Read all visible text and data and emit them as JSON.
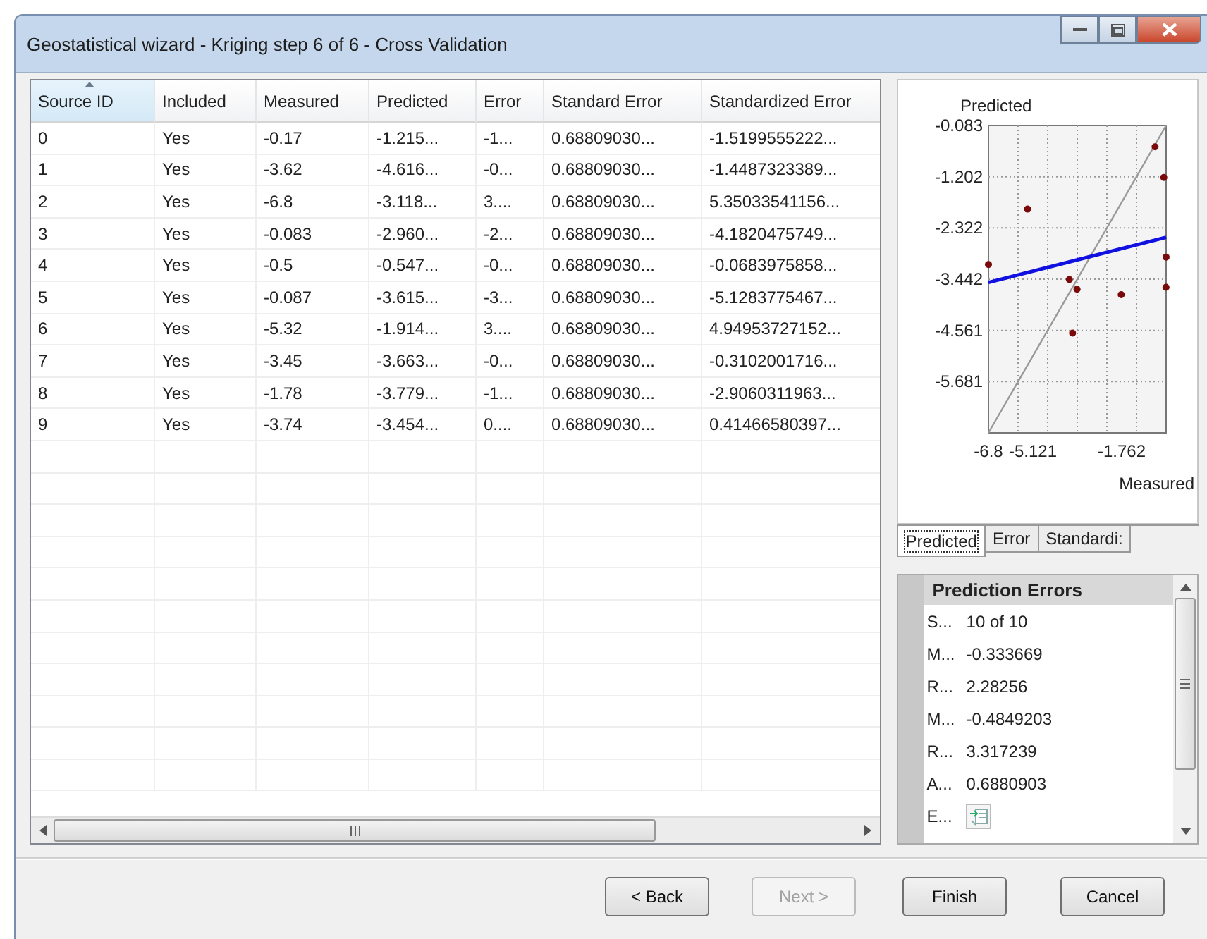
{
  "window": {
    "title": "Geostatistical wizard - Kriging step 6 of 6 - Cross Validation"
  },
  "table": {
    "columns": [
      {
        "label": "Source ID",
        "sorted": true
      },
      {
        "label": "Included",
        "sorted": false
      },
      {
        "label": "Measured",
        "sorted": false
      },
      {
        "label": "Predicted",
        "sorted": false
      },
      {
        "label": "Error",
        "sorted": false
      },
      {
        "label": "Standard Error",
        "sorted": false
      },
      {
        "label": "Standardized Error",
        "sorted": false
      }
    ],
    "rows": [
      [
        "0",
        "Yes",
        "-0.17",
        "-1.215...",
        "-1...",
        "0.68809030...",
        "-1.5199555222..."
      ],
      [
        "1",
        "Yes",
        "-3.62",
        "-4.616...",
        "-0...",
        "0.68809030...",
        "-1.4487323389..."
      ],
      [
        "2",
        "Yes",
        "-6.8",
        "-3.118...",
        "3....",
        "0.68809030...",
        "5.35033541156..."
      ],
      [
        "3",
        "Yes",
        "-0.083",
        "-2.960...",
        "-2...",
        "0.68809030...",
        "-4.1820475749..."
      ],
      [
        "4",
        "Yes",
        "-0.5",
        "-0.547...",
        "-0...",
        "0.68809030...",
        "-0.0683975858..."
      ],
      [
        "5",
        "Yes",
        "-0.087",
        "-3.615...",
        "-3...",
        "0.68809030...",
        "-5.1283775467..."
      ],
      [
        "6",
        "Yes",
        "-5.32",
        "-1.914...",
        "3....",
        "0.68809030...",
        "4.94953727152..."
      ],
      [
        "7",
        "Yes",
        "-3.45",
        "-3.663...",
        "-0...",
        "0.68809030...",
        "-0.3102001716..."
      ],
      [
        "8",
        "Yes",
        "-1.78",
        "-3.779...",
        "-1...",
        "0.68809030...",
        "-2.9060311963..."
      ],
      [
        "9",
        "Yes",
        "-3.74",
        "-3.454...",
        "0....",
        "0.68809030...",
        "0.41466580397..."
      ]
    ]
  },
  "chart": {
    "chart_data": {
      "type": "scatter",
      "title": "Predicted",
      "xlabel": "Measured",
      "x": [
        -0.17,
        -3.62,
        -6.8,
        -0.083,
        -0.5,
        -0.087,
        -5.32,
        -3.45,
        -1.78,
        -3.74
      ],
      "series": [
        {
          "color": "#7a0a0a",
          "values": [
            -1.22,
            -4.62,
            -3.12,
            -2.96,
            -0.55,
            -3.62,
            -1.91,
            -3.66,
            -3.78,
            -3.45
          ]
        }
      ],
      "grid": true,
      "xlim": [
        -6.8,
        -0.083
      ],
      "ylim": [
        -6.8,
        -0.083
      ],
      "xticks": [
        -6.8,
        -5.121,
        -1.762
      ],
      "yticks": [
        -0.083,
        -1.202,
        -2.322,
        -3.442,
        -4.561,
        -5.681
      ]
    }
  },
  "chart_tabs": [
    {
      "label": "Predicted",
      "selected": true
    },
    {
      "label": "Error",
      "selected": false
    },
    {
      "label": "Standardi:",
      "selected": false
    }
  ],
  "prediction_errors": {
    "title": "Prediction Errors",
    "rows": [
      {
        "kind": "value",
        "label": "S...",
        "value": "10 of 10"
      },
      {
        "kind": "value",
        "label": "M...",
        "value": "-0.333669"
      },
      {
        "kind": "value",
        "label": "R...",
        "value": "2.28256"
      },
      {
        "kind": "value",
        "label": "M...",
        "value": "-0.4849203"
      },
      {
        "kind": "value",
        "label": "R...",
        "value": "3.317239"
      },
      {
        "kind": "value",
        "label": "A...",
        "value": "0.6880903"
      },
      {
        "kind": "icon",
        "label": "E..."
      }
    ]
  },
  "buttons": [
    {
      "label": "< Back",
      "disabled": false
    },
    {
      "label": "Next >",
      "disabled": true
    },
    {
      "label": "Finish",
      "disabled": false
    },
    {
      "label": "Cancel",
      "disabled": false
    }
  ]
}
